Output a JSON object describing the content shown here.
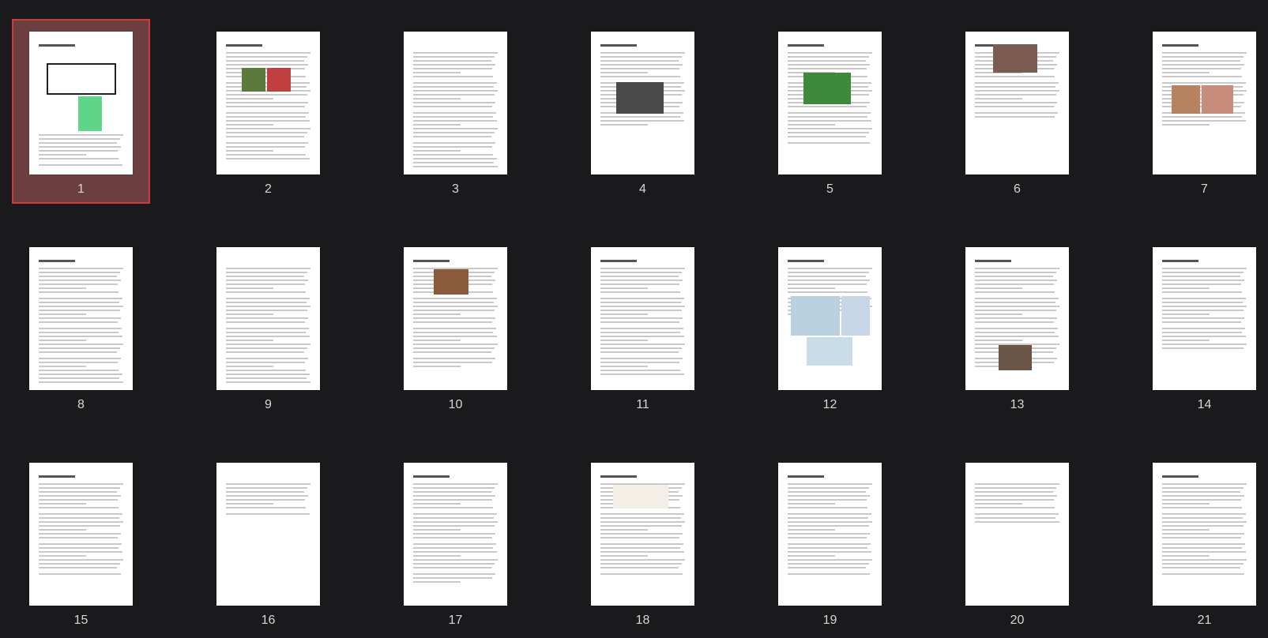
{
  "viewer": {
    "selected_page": 1,
    "colors": {
      "background": "#1a1a1c",
      "selection_fill": "#6b3f40",
      "selection_border": "#d23a3a",
      "page_number_text": "#d6d6d6"
    }
  },
  "pages": [
    {
      "number": "1"
    },
    {
      "number": "2"
    },
    {
      "number": "3"
    },
    {
      "number": "4"
    },
    {
      "number": "5"
    },
    {
      "number": "6"
    },
    {
      "number": "7"
    },
    {
      "number": "8"
    },
    {
      "number": "9"
    },
    {
      "number": "10"
    },
    {
      "number": "11"
    },
    {
      "number": "12"
    },
    {
      "number": "13"
    },
    {
      "number": "14"
    },
    {
      "number": "15"
    },
    {
      "number": "16"
    },
    {
      "number": "17"
    },
    {
      "number": "18"
    },
    {
      "number": "19"
    },
    {
      "number": "20"
    },
    {
      "number": "21"
    }
  ]
}
